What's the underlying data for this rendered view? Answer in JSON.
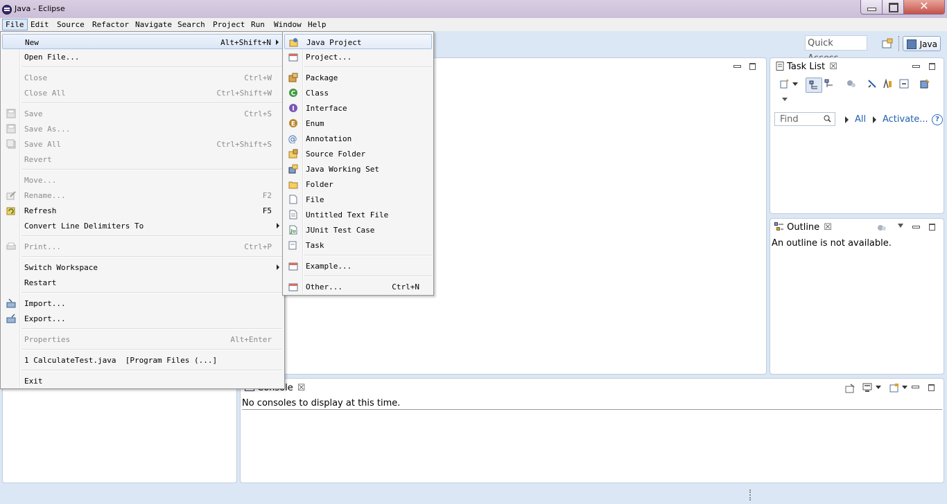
{
  "window": {
    "title": "Java - Eclipse"
  },
  "menubar": [
    "File",
    "Edit",
    "Source",
    "Refactor",
    "Navigate",
    "Search",
    "Project",
    "Run",
    "Window",
    "Help"
  ],
  "toolbar": {
    "quick_access_placeholder": "Quick Access",
    "perspective_label": "Java"
  },
  "file_menu": {
    "items": [
      {
        "label": "New",
        "shortcut": "Alt+Shift+N",
        "submenu": true,
        "highlighted": true
      },
      {
        "label": "Open File...",
        "shortcut": ""
      },
      {
        "label": "Close",
        "shortcut": "Ctrl+W",
        "disabled": true
      },
      {
        "label": "Close All",
        "shortcut": "Ctrl+Shift+W",
        "disabled": true
      },
      {
        "label": "Save",
        "shortcut": "Ctrl+S",
        "disabled": true
      },
      {
        "label": "Save As...",
        "shortcut": "",
        "disabled": true
      },
      {
        "label": "Save All",
        "shortcut": "Ctrl+Shift+S",
        "disabled": true
      },
      {
        "label": "Revert",
        "shortcut": "",
        "disabled": true
      },
      {
        "label": "Move...",
        "shortcut": "",
        "disabled": true
      },
      {
        "label": "Rename...",
        "shortcut": "F2",
        "disabled": true
      },
      {
        "label": "Refresh",
        "shortcut": "F5"
      },
      {
        "label": "Convert Line Delimiters To",
        "shortcut": "",
        "submenu": true
      },
      {
        "label": "Print...",
        "shortcut": "Ctrl+P",
        "disabled": true
      },
      {
        "label": "Switch Workspace",
        "shortcut": "",
        "submenu": true
      },
      {
        "label": "Restart",
        "shortcut": ""
      },
      {
        "label": "Import...",
        "shortcut": ""
      },
      {
        "label": "Export...",
        "shortcut": ""
      },
      {
        "label": "Properties",
        "shortcut": "Alt+Enter",
        "disabled": true
      },
      {
        "label": "1 CalculateTest.java  [Program Files (...]",
        "shortcut": ""
      },
      {
        "label": "Exit",
        "shortcut": ""
      }
    ]
  },
  "new_menu": {
    "items": [
      {
        "label": "Java Project",
        "shortcut": ""
      },
      {
        "label": "Project...",
        "shortcut": ""
      },
      {
        "label": "Package",
        "shortcut": ""
      },
      {
        "label": "Class",
        "shortcut": ""
      },
      {
        "label": "Interface",
        "shortcut": ""
      },
      {
        "label": "Enum",
        "shortcut": ""
      },
      {
        "label": "Annotation",
        "shortcut": ""
      },
      {
        "label": "Source Folder",
        "shortcut": ""
      },
      {
        "label": "Java Working Set",
        "shortcut": ""
      },
      {
        "label": "Folder",
        "shortcut": ""
      },
      {
        "label": "File",
        "shortcut": ""
      },
      {
        "label": "Untitled Text File",
        "shortcut": ""
      },
      {
        "label": "JUnit Test Case",
        "shortcut": ""
      },
      {
        "label": "Task",
        "shortcut": ""
      },
      {
        "label": "Example...",
        "shortcut": ""
      },
      {
        "label": "Other...",
        "shortcut": "Ctrl+N"
      }
    ]
  },
  "task_list": {
    "title": "Task List",
    "find_placeholder": "Find",
    "all_link": "All",
    "activate_link": "Activate..."
  },
  "outline": {
    "title": "Outline",
    "message": "An outline is not available."
  },
  "console": {
    "title": "Console",
    "message": "No consoles to display at this time."
  }
}
